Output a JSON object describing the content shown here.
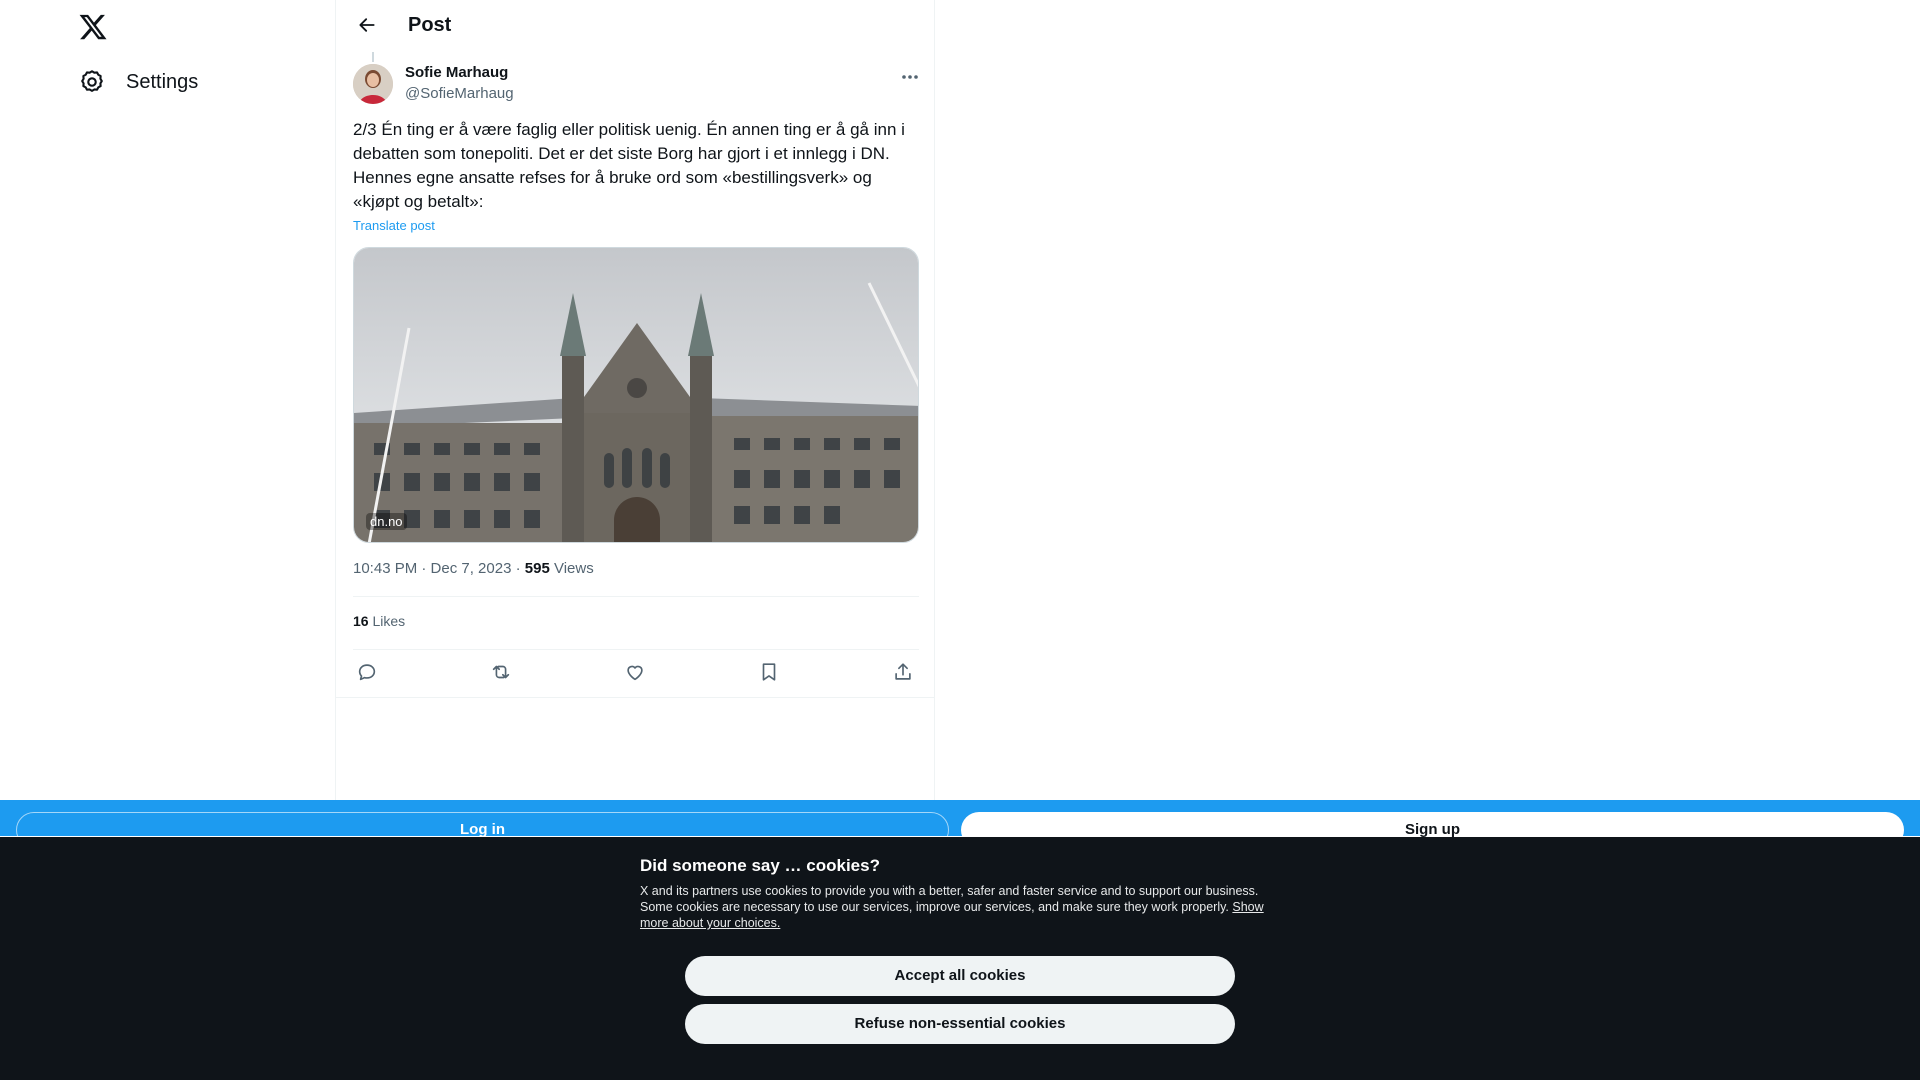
{
  "nav": {
    "logo_icon": "x-logo-icon",
    "settings_label": "Settings",
    "settings_icon": "gear-icon"
  },
  "header": {
    "title": "Post",
    "back_icon": "arrow-left-icon"
  },
  "post": {
    "author_name": "Sofie Marhaug",
    "author_handle": "@SofieMarhaug",
    "text": "2/3 Én ting er å være faglig eller politisk uenig. Én annen ting er å gå inn i debatten som tonepoliti. Det er det siste Borg har gjort i et innlegg i DN. Hennes egne ansatte refses for å bruke ord som «bestillingsverk» og «kjøpt og betalt»:",
    "translate_label": "Translate post",
    "media_domain": "dn.no",
    "time": "10:43 PM · Dec 7, 2023 · ",
    "views_count": "595",
    "views_label": " Views",
    "likes_count": "16",
    "likes_label": " Likes"
  },
  "actions": [
    {
      "name": "reply",
      "icon": "reply-icon"
    },
    {
      "name": "repost",
      "icon": "repost-icon"
    },
    {
      "name": "like",
      "icon": "heart-icon"
    },
    {
      "name": "bookmark",
      "icon": "bookmark-icon"
    },
    {
      "name": "share",
      "icon": "share-icon"
    }
  ],
  "bottom_bar": {
    "login_label": "Log in",
    "signup_label": "Sign up"
  },
  "cookies": {
    "title": "Did someone say … cookies?",
    "body": "X and its partners use cookies to provide you with a better, safer and faster service and to support our business. Some cookies are necessary to use our services, improve our services, and make sure they work properly. ",
    "link_label": "Show more about your choices.",
    "accept_label": "Accept all cookies",
    "refuse_label": "Refuse non-essential cookies"
  },
  "colors": {
    "accent": "#1d9bf0",
    "text_primary": "#0f1419",
    "text_secondary": "#536471",
    "banner_bg": "#0f1419"
  }
}
